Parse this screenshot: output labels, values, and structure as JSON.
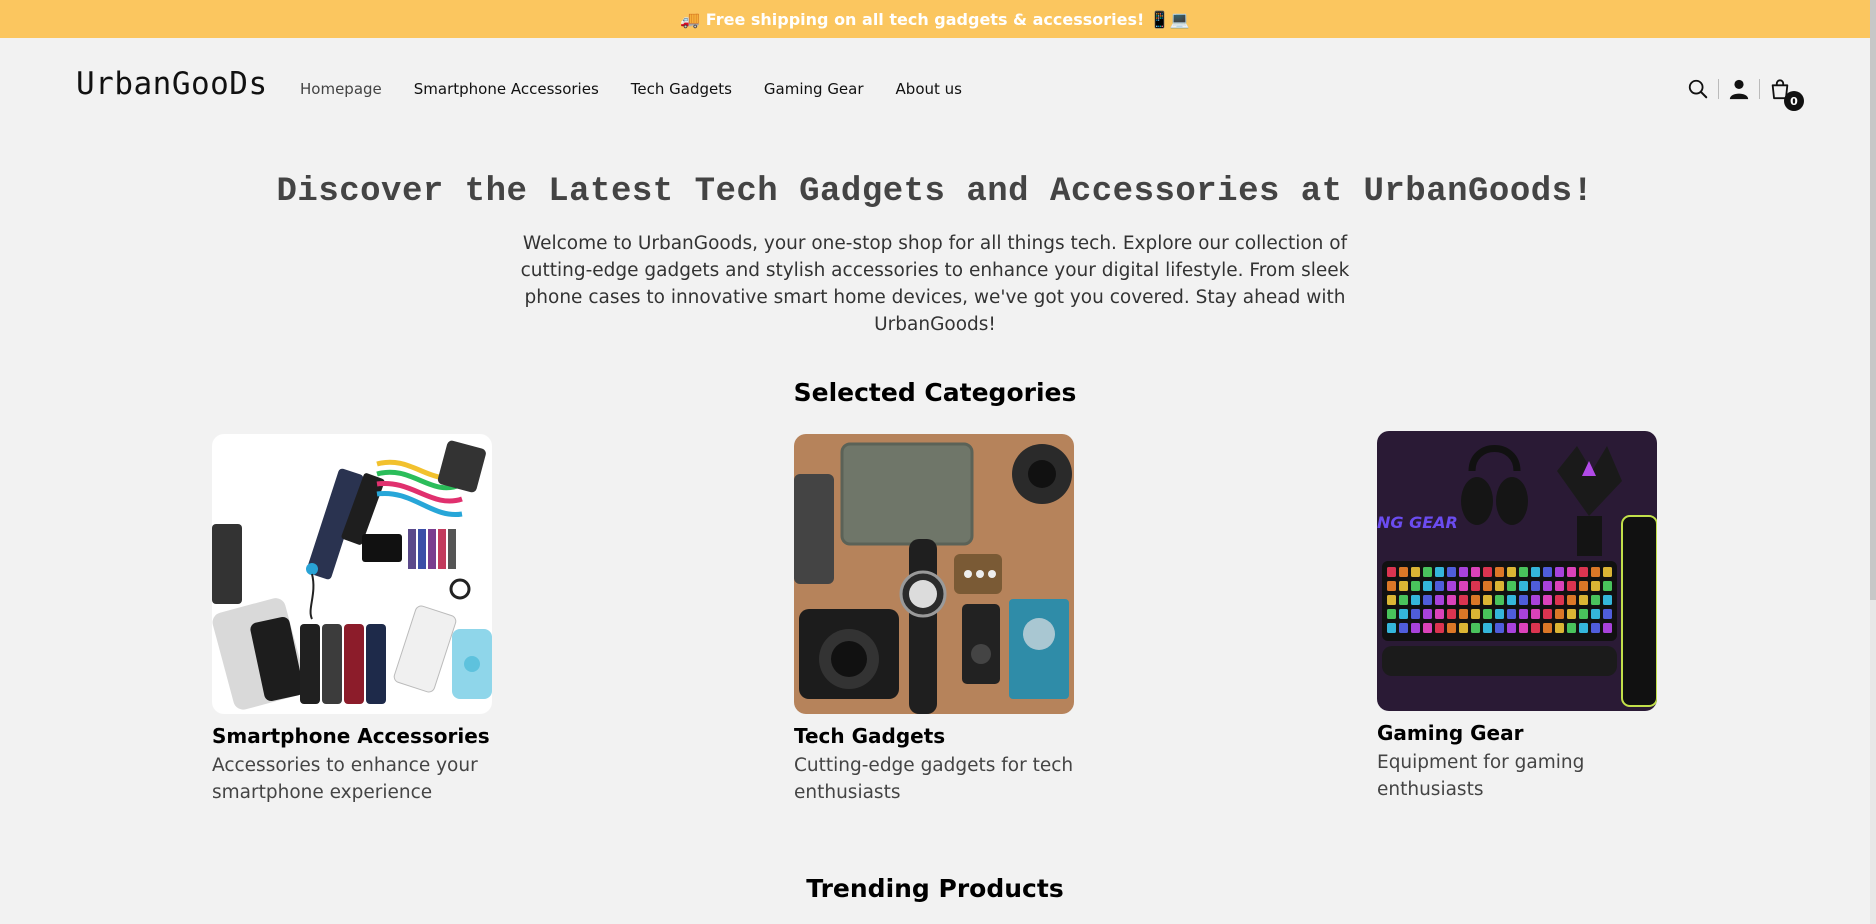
{
  "announcement": {
    "text": "🚚 Free shipping on all tech gadgets & accessories! 📱💻"
  },
  "header": {
    "logo": "UrbanGooDs",
    "nav": [
      "Homepage",
      "Smartphone Accessories",
      "Tech Gadgets",
      "Gaming Gear",
      "About us"
    ],
    "icons": [
      "search-icon",
      "account-icon",
      "cart-icon"
    ],
    "cart_count": "0"
  },
  "hero": {
    "title": "Discover the Latest Tech Gadgets and Accessories at UrbanGoods!",
    "text": "Welcome to UrbanGoods, your one-stop shop for all things tech. Explore our collection of cutting-edge gadgets and stylish accessories to enhance your digital lifestyle. From sleek phone cases to innovative smart home devices, we've got you covered. Stay ahead with UrbanGoods!"
  },
  "categories": {
    "title": "Selected Categories",
    "items": [
      {
        "name": "Smartphone Accessories",
        "desc": "Accessories to enhance your smartphone experience"
      },
      {
        "name": "Tech Gadgets",
        "desc": "Cutting-edge gadgets for tech enthusiasts"
      },
      {
        "name": "Gaming Gear",
        "desc": "Equipment for gaming enthusiasts",
        "image_text": "NG GEAR"
      }
    ]
  },
  "trending": {
    "title": "Trending Products"
  },
  "colors": {
    "announcement_bg": "#fbc65f",
    "page_bg": "#f2f2f2"
  }
}
